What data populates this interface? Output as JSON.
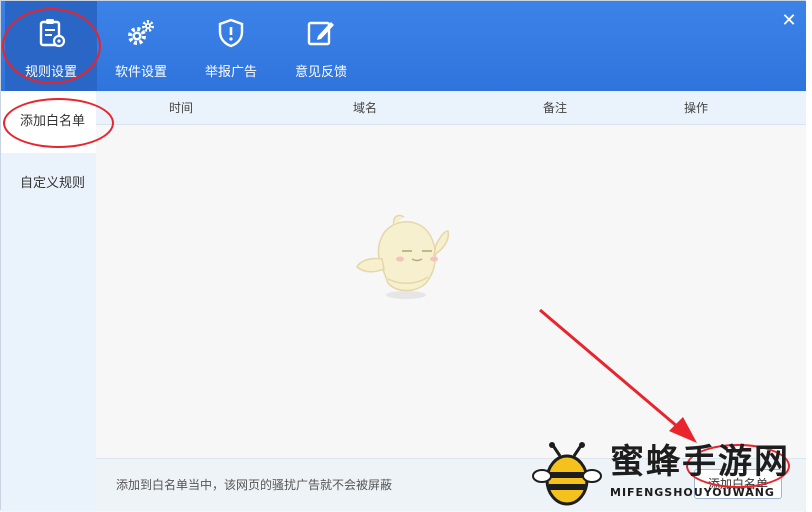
{
  "header": {
    "tabs": [
      {
        "label": "规则设置",
        "icon": "clipboard-gear-icon",
        "active": true
      },
      {
        "label": "软件设置",
        "icon": "gears-icon",
        "active": false
      },
      {
        "label": "举报广告",
        "icon": "shield-alert-icon",
        "active": false
      },
      {
        "label": "意见反馈",
        "icon": "pencil-edit-icon",
        "active": false
      }
    ],
    "close_label": "✕"
  },
  "sidebar": {
    "items": [
      {
        "label": "添加白名单",
        "active": true
      },
      {
        "label": "自定义规则",
        "active": false
      }
    ]
  },
  "table": {
    "columns": [
      "时间",
      "域名",
      "备注",
      "操作"
    ],
    "rows": []
  },
  "footer": {
    "hint": "添加到白名单当中，该网页的骚扰广告就不会被屏蔽",
    "add_button": "添加白名单"
  },
  "watermark": {
    "title": "蜜蜂手游网",
    "subtitle": "MIFENGSHOUYOUWANG"
  },
  "colors": {
    "header": "#3079e0",
    "sidebar": "#eaf3fb",
    "annotation": "#e8242d"
  }
}
